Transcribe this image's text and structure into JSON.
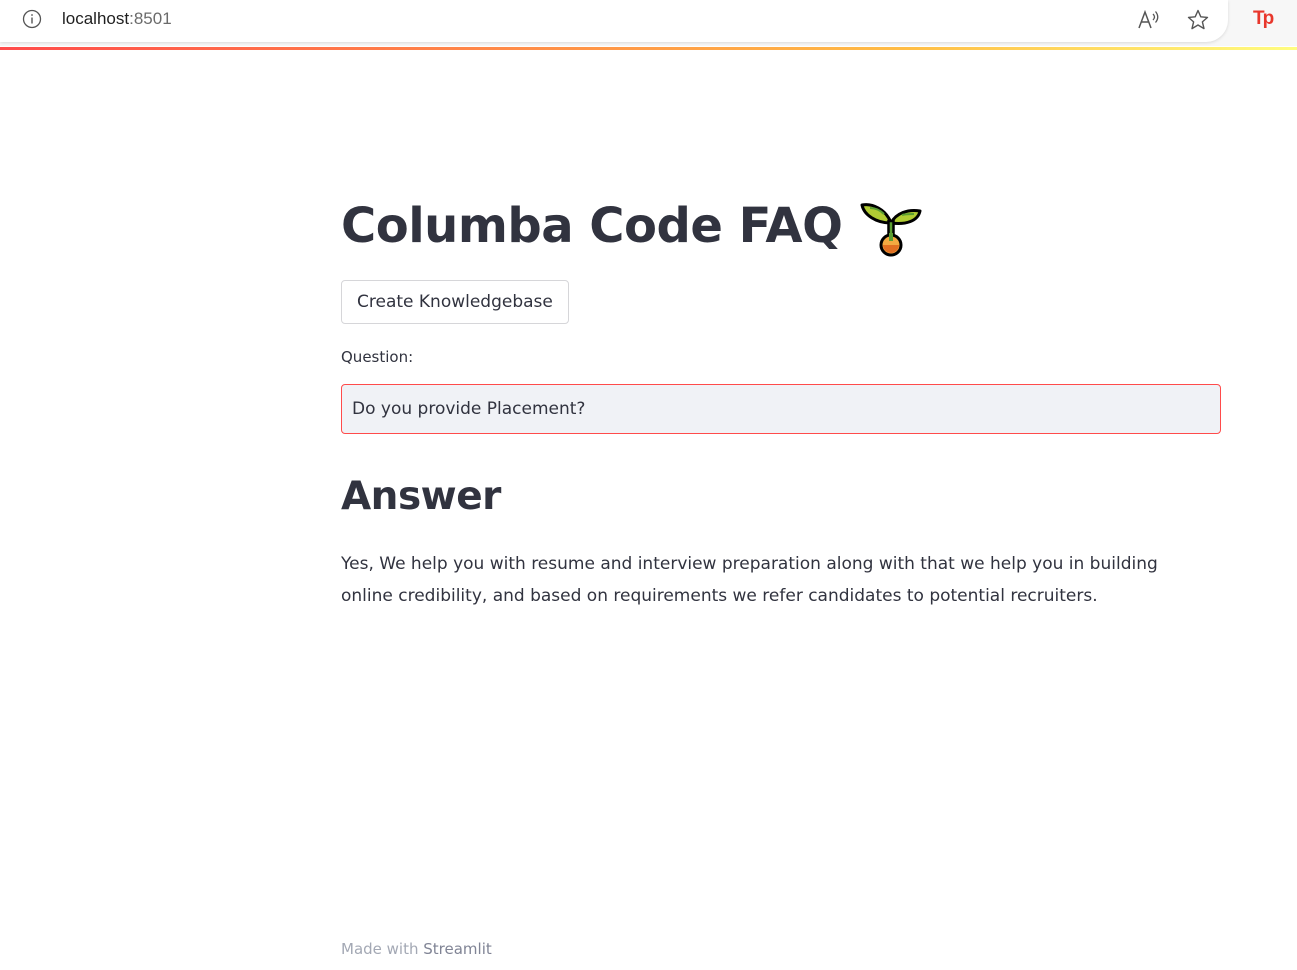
{
  "browser": {
    "url_host": "localhost",
    "url_port": ":8501",
    "extension_label": "Tp",
    "icons": [
      "info-icon",
      "read-aloud-icon",
      "favorite-star-icon",
      "extension-icon"
    ]
  },
  "page": {
    "title": "Columba Code FAQ",
    "title_icon": "sprout-icon",
    "create_button_label": "Create Knowledgebase",
    "question_label": "Question:",
    "question_value": "Do you provide Placement?",
    "answer_heading": "Answer",
    "answer_text": "Yes, We help you with resume and interview preparation along with that we help you in building online credibility, and based on requirements we refer candidates to potential recruiters."
  },
  "footer": {
    "prefix": "Made with",
    "brand": "Streamlit"
  },
  "colors": {
    "accent": "#ff4b4b",
    "text": "#31333f",
    "input_bg": "#f0f2f6"
  }
}
